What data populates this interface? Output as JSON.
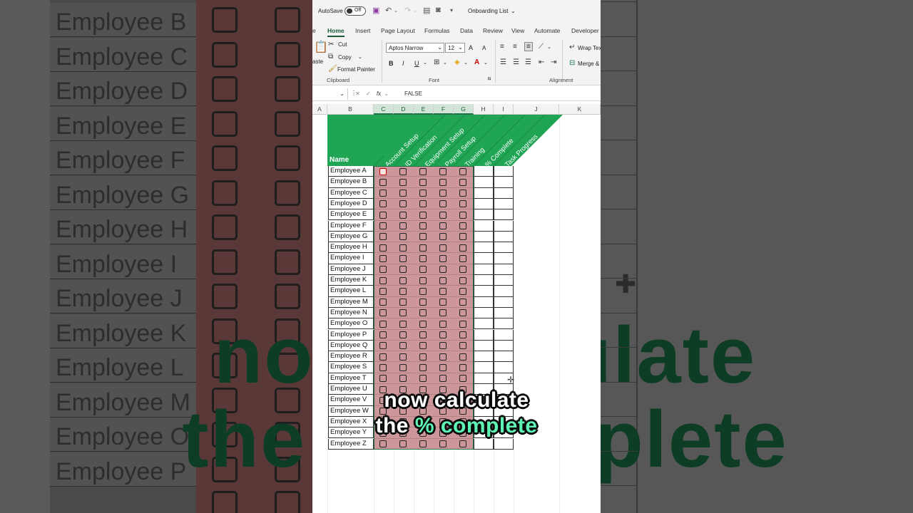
{
  "window": {
    "title": "Onboarding List"
  },
  "quick_access": {
    "autosave_label": "AutoSave",
    "autosave_state": "Off"
  },
  "tabs": [
    "e",
    "Home",
    "Insert",
    "Page Layout",
    "Formulas",
    "Data",
    "Review",
    "View",
    "Automate",
    "Developer"
  ],
  "ribbon": {
    "clipboard": {
      "paste": "aste",
      "cut": "Cut",
      "copy": "Copy",
      "format_painter": "Format Painter",
      "label": "Clipboard"
    },
    "font": {
      "name": "Aptos Narrow",
      "size": "12",
      "bold": "B",
      "italic": "I",
      "underline": "U",
      "grow": "A",
      "shrink": "A",
      "label": "Font"
    },
    "alignment": {
      "wrap": "Wrap Tex",
      "merge": "Merge &",
      "label": "Alignment"
    }
  },
  "formula_bar": {
    "fx": "fx",
    "value": "FALSE"
  },
  "columns": [
    "A",
    "B",
    "C",
    "D",
    "E",
    "F",
    "G",
    "H",
    "I",
    "J",
    "K"
  ],
  "table": {
    "name_header": "Name",
    "task_headers": [
      "Account Setup",
      "ID Verification",
      "Equipment Setup",
      "Payroll Setup",
      "Training",
      "% Complete",
      "Task Progress"
    ],
    "employees": [
      "Employee A",
      "Employee B",
      "Employee C",
      "Employee D",
      "Employee E",
      "Employee F",
      "Employee G",
      "Employee H",
      "Employee I",
      "Employee J",
      "Employee K",
      "Employee L",
      "Employee M",
      "Employee N",
      "Employee O",
      "Employee P",
      "Employee Q",
      "Employee R",
      "Employee S",
      "Employee T",
      "Employee U",
      "Employee V",
      "Employee W",
      "Employee X",
      "Employee Y",
      "Employee Z"
    ]
  },
  "caption": {
    "line1": "now calculate",
    "line2": "the % complete"
  },
  "background": {
    "names": [
      "Employee B",
      "Employee C",
      "Employee D",
      "Employee E",
      "Employee F",
      "Employee G",
      "Employee H",
      "Employee I",
      "Employee J",
      "Employee K",
      "Employee L",
      "Employee M",
      "Employee O",
      "Employee P"
    ],
    "caption_line1": "now calculate",
    "caption_line2": "the % complete"
  },
  "colors": {
    "header_green": "#1fa554",
    "checkbox_fill": "#cd969a",
    "caption_accent": "#5ef5b5"
  }
}
